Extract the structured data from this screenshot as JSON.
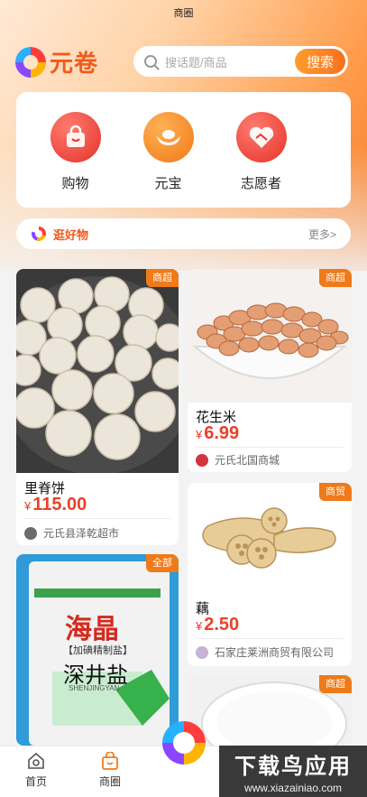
{
  "status_title": "商圈",
  "brand": {
    "name": "元卷"
  },
  "search": {
    "placeholder": "搜话题/商品",
    "button": "搜索"
  },
  "quick_entries": [
    {
      "label": "购物",
      "icon": "shopping-bag-icon"
    },
    {
      "label": "元宝",
      "icon": "gold-ingot-icon"
    },
    {
      "label": "志愿者",
      "icon": "handshake-heart-icon"
    }
  ],
  "browse": {
    "title": "逛好物",
    "more": "更多>"
  },
  "products": [
    {
      "tag": "商超",
      "name": "里脊饼",
      "currency": "¥",
      "price": "115.00",
      "shop": "元氏县泽乾超市"
    },
    {
      "tag": "商超",
      "name": "花生米",
      "currency": "¥",
      "price": "6.99",
      "shop": "元氏北国商城"
    },
    {
      "tag": "商贸",
      "name": "藕",
      "currency": "¥",
      "price": "2.50",
      "shop": "石家庄莱洲商贸有限公司"
    },
    {
      "tag": "全部",
      "name": "",
      "currency": "",
      "price": "",
      "shop": "",
      "pack_brand": "海晶",
      "pack_sub": "【加碘精制盐】",
      "pack_name": "深井盐",
      "pack_pinyin": "SHENJINGYAN"
    },
    {
      "tag": "商超"
    }
  ],
  "tabbar": [
    {
      "label": "首页",
      "icon": "home-icon"
    },
    {
      "label": "商圈",
      "icon": "shop-bag-icon"
    }
  ],
  "watermark": {
    "title": "下载鸟应用",
    "url": "www.xiazainiao.com"
  },
  "colors": {
    "brand_orange": "#f25a1c",
    "price_red": "#e8412a",
    "tag_orange": "#ee7a1a"
  }
}
